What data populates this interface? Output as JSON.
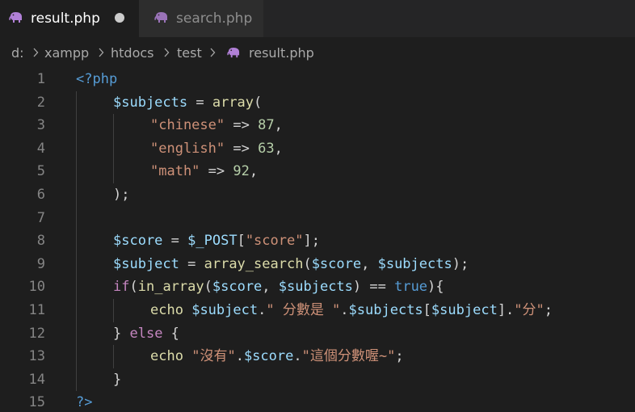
{
  "tabs": [
    {
      "label": "result.php",
      "active": true,
      "modified": true,
      "icon": "php-elephant-icon"
    },
    {
      "label": "search.php",
      "active": false,
      "modified": false,
      "icon": "php-elephant-icon"
    }
  ],
  "breadcrumb": {
    "segments": [
      "d:",
      "xampp",
      "htdocs",
      "test",
      "result.php"
    ]
  },
  "editor": {
    "line_numbers": [
      "1",
      "2",
      "3",
      "4",
      "5",
      "6",
      "7",
      "8",
      "9",
      "10",
      "11",
      "12",
      "13",
      "14",
      "15"
    ],
    "lines": [
      [
        {
          "t": "tag",
          "v": "<?php"
        }
      ],
      [
        {
          "t": "var",
          "v": "$subjects"
        },
        {
          "t": "op",
          "v": " = "
        },
        {
          "t": "fn",
          "v": "array"
        },
        {
          "t": "op",
          "v": "("
        }
      ],
      [
        {
          "t": "str",
          "v": "\"chinese\""
        },
        {
          "t": "op",
          "v": " => "
        },
        {
          "t": "num",
          "v": "87"
        },
        {
          "t": "op",
          "v": ","
        }
      ],
      [
        {
          "t": "str",
          "v": "\"english\""
        },
        {
          "t": "op",
          "v": " => "
        },
        {
          "t": "num",
          "v": "63"
        },
        {
          "t": "op",
          "v": ","
        }
      ],
      [
        {
          "t": "str",
          "v": "\"math\""
        },
        {
          "t": "op",
          "v": " => "
        },
        {
          "t": "num",
          "v": "92"
        },
        {
          "t": "op",
          "v": ","
        }
      ],
      [
        {
          "t": "op",
          "v": ");"
        }
      ],
      [],
      [
        {
          "t": "var",
          "v": "$score"
        },
        {
          "t": "op",
          "v": " = "
        },
        {
          "t": "var",
          "v": "$_POST"
        },
        {
          "t": "op",
          "v": "["
        },
        {
          "t": "str",
          "v": "\"score\""
        },
        {
          "t": "op",
          "v": "];"
        }
      ],
      [
        {
          "t": "var",
          "v": "$subject"
        },
        {
          "t": "op",
          "v": " = "
        },
        {
          "t": "fn",
          "v": "array_search"
        },
        {
          "t": "op",
          "v": "("
        },
        {
          "t": "var",
          "v": "$score"
        },
        {
          "t": "op",
          "v": ", "
        },
        {
          "t": "var",
          "v": "$subjects"
        },
        {
          "t": "op",
          "v": ");"
        }
      ],
      [
        {
          "t": "kw",
          "v": "if"
        },
        {
          "t": "op",
          "v": "("
        },
        {
          "t": "fn",
          "v": "in_array"
        },
        {
          "t": "op",
          "v": "("
        },
        {
          "t": "var",
          "v": "$score"
        },
        {
          "t": "op",
          "v": ", "
        },
        {
          "t": "var",
          "v": "$subjects"
        },
        {
          "t": "op",
          "v": ") == "
        },
        {
          "t": "const",
          "v": "true"
        },
        {
          "t": "op",
          "v": "){"
        }
      ],
      [
        {
          "t": "fn",
          "v": "echo"
        },
        {
          "t": "op",
          "v": " "
        },
        {
          "t": "var",
          "v": "$subject"
        },
        {
          "t": "op",
          "v": "."
        },
        {
          "t": "str",
          "v": "\" 分數是 \""
        },
        {
          "t": "op",
          "v": "."
        },
        {
          "t": "var",
          "v": "$subjects"
        },
        {
          "t": "op",
          "v": "["
        },
        {
          "t": "var",
          "v": "$subject"
        },
        {
          "t": "op",
          "v": "]."
        },
        {
          "t": "str",
          "v": "\"分\""
        },
        {
          "t": "op",
          "v": ";"
        }
      ],
      [
        {
          "t": "op",
          "v": "} "
        },
        {
          "t": "kw",
          "v": "else"
        },
        {
          "t": "op",
          "v": " {"
        }
      ],
      [
        {
          "t": "fn",
          "v": "echo"
        },
        {
          "t": "op",
          "v": " "
        },
        {
          "t": "str",
          "v": "\"沒有\""
        },
        {
          "t": "op",
          "v": "."
        },
        {
          "t": "var",
          "v": "$score"
        },
        {
          "t": "op",
          "v": "."
        },
        {
          "t": "str",
          "v": "\"這個分數喔~\""
        },
        {
          "t": "op",
          "v": ";"
        }
      ],
      [
        {
          "t": "op",
          "v": "}"
        }
      ],
      [
        {
          "t": "tag",
          "v": "?>"
        }
      ]
    ],
    "indent_levels": [
      0,
      1,
      2,
      2,
      2,
      1,
      0,
      1,
      1,
      1,
      2,
      1,
      2,
      1,
      0
    ]
  },
  "colors": {
    "background": "#1e1e1e",
    "tab_bar": "#252526",
    "keyword_blue": "#569cd6",
    "variable": "#9cdcfe",
    "function": "#dcdcaa",
    "string": "#ce9178",
    "number": "#b5cea8",
    "control": "#c586c0",
    "php_icon": "#b180d7"
  }
}
